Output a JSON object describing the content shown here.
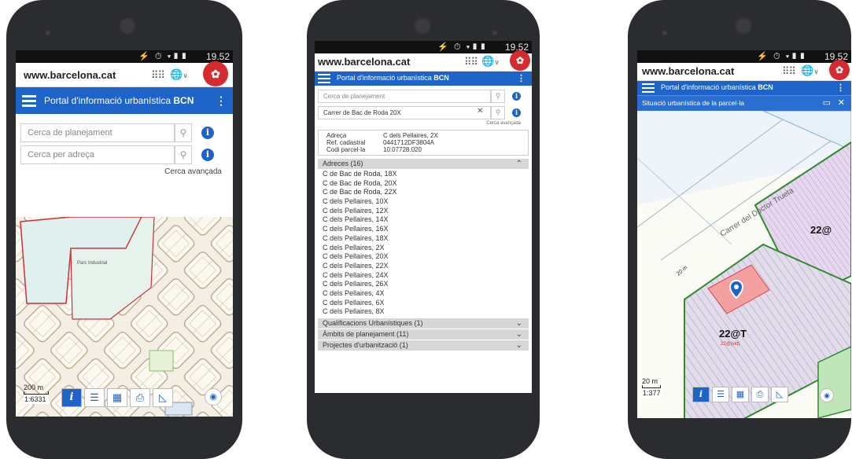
{
  "common": {
    "domain": "www.barcelona.cat",
    "time": "19.52",
    "status_icons": "⚡ ⏱ ▾▮▮",
    "grid_icon": "⠿⠿",
    "globe_icon": "🌐",
    "globe_caret": "∨",
    "logo_icon": "✿",
    "kebab": "⋮",
    "search_icon": "⚲",
    "info_icon": "i",
    "colors": {
      "brand_blue": "#1e64c8",
      "logo_red": "#d32b2f",
      "zone_green": "#2e8b2e",
      "zone_purple": "#e0d0ec",
      "highlight_red": "#f08a8a"
    }
  },
  "phone1": {
    "title_prefix": "Portal d'informació urbanística",
    "title_bold": "BCN",
    "search_planning_placeholder": "Cerca de planejament",
    "search_address_placeholder": "Cerca per adreça",
    "advanced_search": "Cerca avançada",
    "scale_distance": "200 m",
    "scale_ratio": "1:6331",
    "toolbar": {
      "info": "i",
      "list": "☰",
      "layers": "▦",
      "print": "⎙",
      "measure": "◺"
    },
    "locate_icon": "◉",
    "map_label": "Parc Industrial"
  },
  "phone2": {
    "title_prefix": "Portal d'informació urbanística",
    "title_bold": "BCN",
    "search_planning_placeholder": "Cerca de planejament",
    "search_address_value": "Carrer de Bac de Roda 20X",
    "clear_icon": "✕",
    "advanced_search": "Cerca avançada",
    "details": [
      {
        "key": "Adreça",
        "value": "C dels Pellaires, 2X"
      },
      {
        "key": "Ref. cadastral",
        "value": "0441712DF3804A"
      },
      {
        "key": "Codi parcel·la",
        "value": "10.07728.020"
      }
    ],
    "addresses_header": "Adreces (16)",
    "addresses": [
      "C de Bac de Roda, 18X",
      "C de Bac de Roda, 20X",
      "C de Bac de Roda, 22X",
      "C dels Pellaires, 10X",
      "C dels Pellaires, 12X",
      "C dels Pellaires, 14X",
      "C dels Pellaires, 16X",
      "C dels Pellaires, 18X",
      "C dels Pellaires, 2X",
      "C dels Pellaires, 20X",
      "C dels Pellaires, 22X",
      "C dels Pellaires, 24X",
      "C dels Pellaires, 26X",
      "C dels Pellaires, 4X",
      "C dels Pellaires, 6X",
      "C dels Pellaires, 8X"
    ],
    "sections": [
      "Qualificacions Urbanístiques (1)",
      "Àmbits de planejament (11)",
      "Projectes d'urbanització (1)"
    ],
    "chevron_up": "⌃",
    "chevron_down": "⌄"
  },
  "phone3": {
    "title_prefix": "Portal d'informació urbanística",
    "title_bold": "BCN",
    "subtitle": "Situació urbanística de la parcel·la",
    "window_icon": "▭",
    "close_icon": "✕",
    "street_label": "Carrer del Doctor Trueta",
    "zone_label_1": "22@T",
    "zone_label_2": "22@",
    "zone_small": "22@(vid)",
    "scale_distance": "20 m",
    "scale_ratio": "1:377",
    "toolbar": {
      "info": "i",
      "list": "☰",
      "layers": "▦",
      "print": "⎙",
      "measure": "◺"
    },
    "locate_icon": "◉"
  }
}
